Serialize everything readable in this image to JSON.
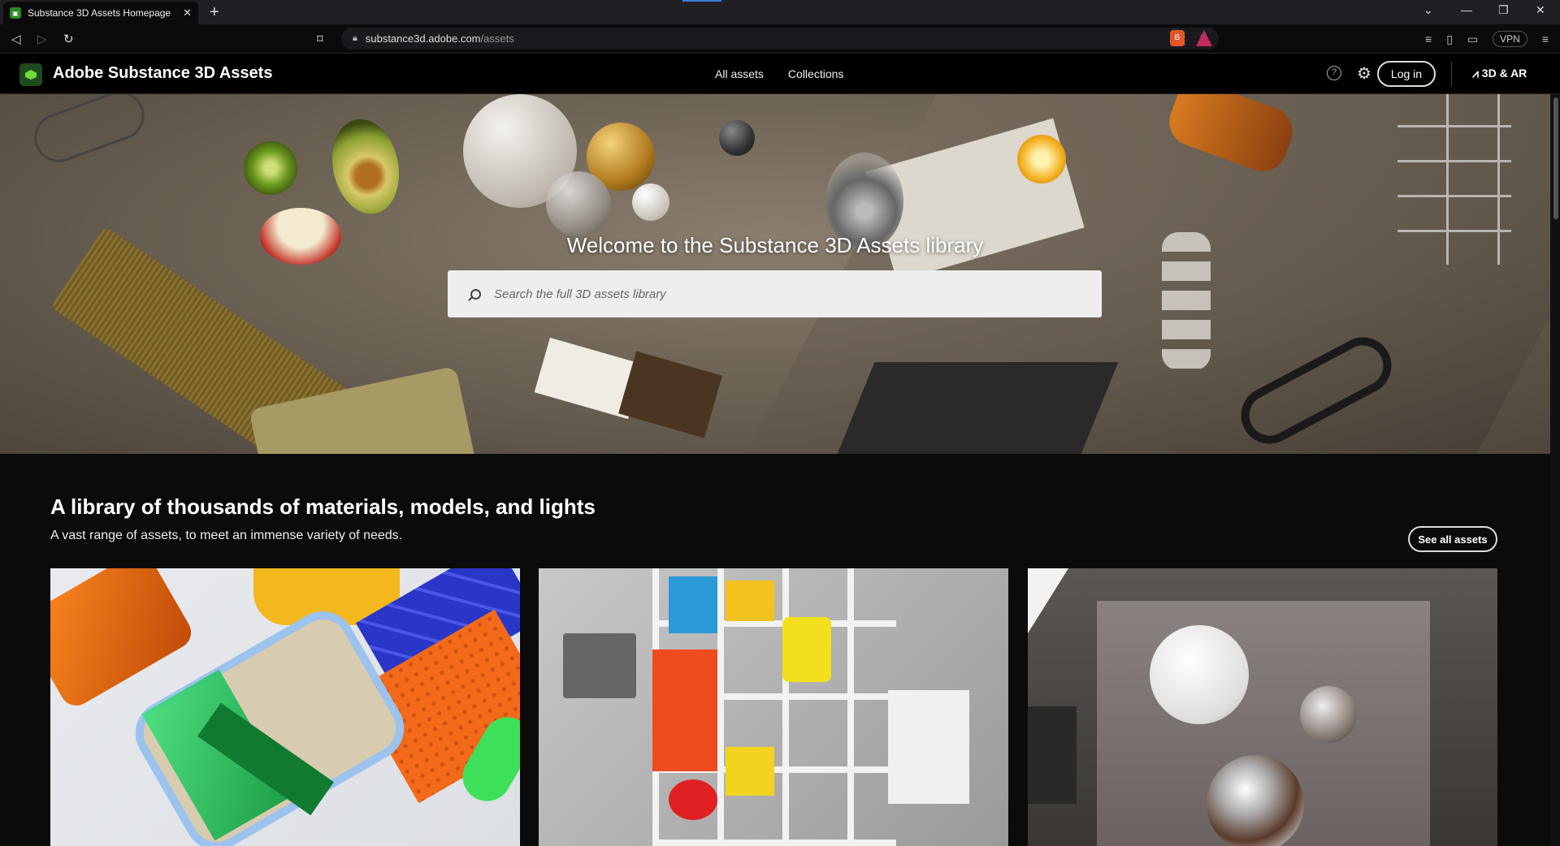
{
  "browser": {
    "tab_title": "Substance 3D Assets Homepage",
    "tab_close": "✕",
    "new_tab": "+",
    "url_domain": "substance3d.adobe.com",
    "url_path": "/assets",
    "vpn_label": "VPN",
    "window_minimize": "—",
    "window_restore": "❐",
    "window_close": "✕",
    "tab_list": "⌄"
  },
  "header": {
    "brand": "Adobe Substance 3D Assets",
    "nav": [
      "All assets",
      "Collections"
    ],
    "help": "?",
    "login": "Log in",
    "adobe_link": "3D & AR"
  },
  "hero": {
    "title": "Welcome to the Substance 3D Assets library",
    "search_placeholder": "Search the full 3D assets library"
  },
  "section": {
    "title": "A library of thousands of materials, models, and lights",
    "subtitle": "A vast range of assets, to meet an immense variety of needs.",
    "see_all": "See all assets"
  },
  "colors": {
    "brand_green": "#6fdc3a",
    "background": "#0b0b0b",
    "search_bg": "#eeeeee"
  }
}
